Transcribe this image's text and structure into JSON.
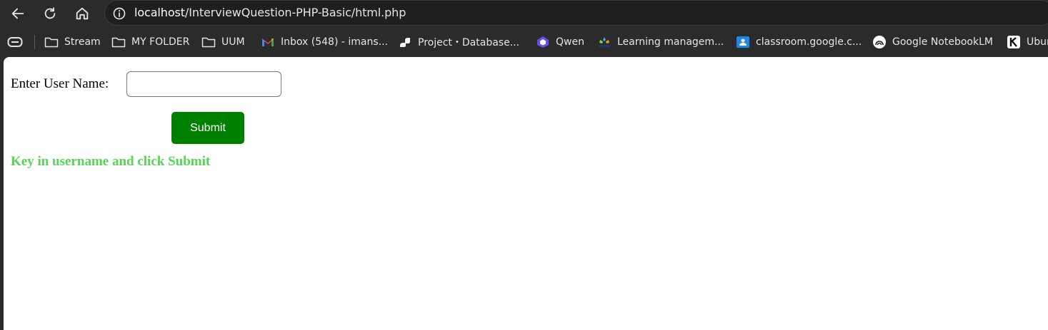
{
  "browser": {
    "url_host": "localhost",
    "url_path": "/InterviewQuestion-PHP-Basic/html.php"
  },
  "bookmarks": [
    {
      "label": "Stream",
      "icon": "folder-icon"
    },
    {
      "label": "MY FOLDER",
      "icon": "folder-icon"
    },
    {
      "label": "UUM",
      "icon": "folder-icon"
    },
    {
      "label": "Inbox (548) - imans...",
      "icon": "gmail-icon"
    },
    {
      "label": "Project・Database...",
      "icon": "supabase-icon"
    },
    {
      "label": "Qwen",
      "icon": "qwen-icon"
    },
    {
      "label": "Learning managem...",
      "icon": "lms-icon"
    },
    {
      "label": "classroom.google.c...",
      "icon": "classroom-icon"
    },
    {
      "label": "Google NotebookLM",
      "icon": "notebooklm-icon"
    },
    {
      "label": "Ubun",
      "icon": "k-icon"
    }
  ],
  "page": {
    "username_label": "Enter User Name:",
    "username_value": "",
    "username_placeholder": "",
    "submit_label": "Submit",
    "hint_text": "Key in username and click Submit",
    "hint_color": "#55d455",
    "submit_color": "#008000"
  }
}
